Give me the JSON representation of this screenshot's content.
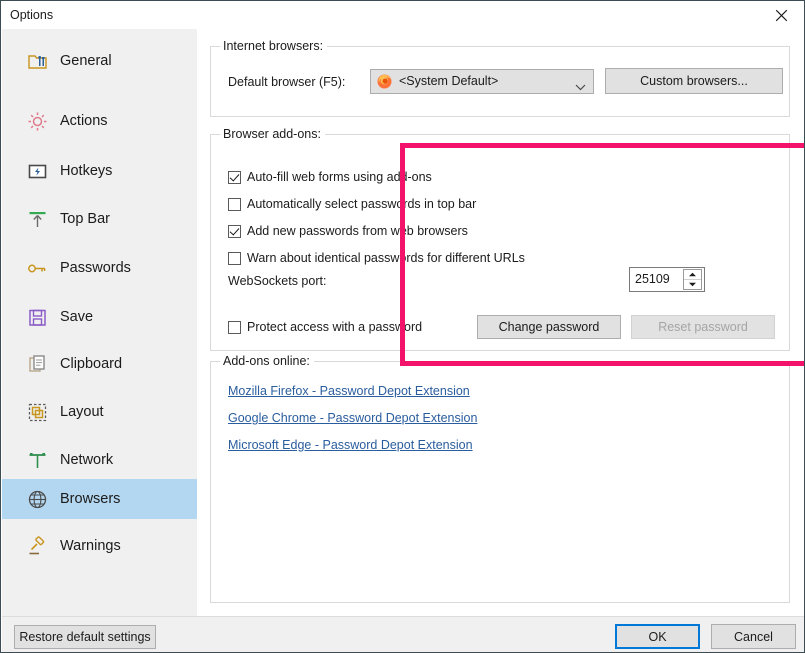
{
  "window": {
    "title": "Options",
    "close_icon": "close-icon"
  },
  "sidebar": {
    "items": [
      {
        "label": "General",
        "icon": "folder-tools-icon"
      },
      {
        "label": "Actions",
        "icon": "gear-icon"
      },
      {
        "label": "Hotkeys",
        "icon": "keyboard-bolt-icon"
      },
      {
        "label": "Top Bar",
        "icon": "arrow-up-bar-icon"
      },
      {
        "label": "Passwords",
        "icon": "key-icon"
      },
      {
        "label": "Save",
        "icon": "floppy-disk-icon"
      },
      {
        "label": "Clipboard",
        "icon": "clipboard-icon"
      },
      {
        "label": "Layout",
        "icon": "layout-icon"
      },
      {
        "label": "Network",
        "icon": "network-icon"
      },
      {
        "label": "Browsers",
        "icon": "globe-icon",
        "selected": true
      },
      {
        "label": "Warnings",
        "icon": "gavel-icon"
      }
    ]
  },
  "main": {
    "internet_browsers": {
      "legend": "Internet browsers:",
      "default_browser_label": "Default browser (F5):",
      "default_browser_value": "<System Default>",
      "default_browser_icon": "firefox-icon",
      "dropdown_icon": "chevron-down-icon",
      "custom_browsers_button": "Custom browsers..."
    },
    "browser_addons": {
      "legend": "Browser add-ons:",
      "checkboxes": [
        {
          "label": "Auto-fill web forms using add-ons",
          "checked": true
        },
        {
          "label": "Automatically select passwords in top bar",
          "checked": false
        },
        {
          "label": "Add new passwords from web browsers",
          "checked": true
        },
        {
          "label": "Warn about identical passwords for different URLs",
          "checked": false
        }
      ],
      "websockets_port_label": "WebSockets port:",
      "websockets_port_value": "25109",
      "spinner_up_icon": "spinner-up-icon",
      "spinner_down_icon": "spinner-down-icon",
      "protect_checkbox": {
        "label": "Protect access with a password",
        "checked": false
      },
      "change_password_button": "Change password",
      "reset_password_button": "Reset password",
      "highlight_color": "#f4136b"
    },
    "addons_online": {
      "legend": "Add-ons online:",
      "links": [
        "Mozilla Firefox - Password Depot Extension",
        "Google Chrome - Password Depot Extension",
        "Microsoft Edge - Password Depot Extension"
      ],
      "link_color": "#2a5d9e"
    }
  },
  "footer": {
    "restore_button": "Restore default settings",
    "ok_button": "OK",
    "cancel_button": "Cancel",
    "focus_color": "#0078d7"
  }
}
